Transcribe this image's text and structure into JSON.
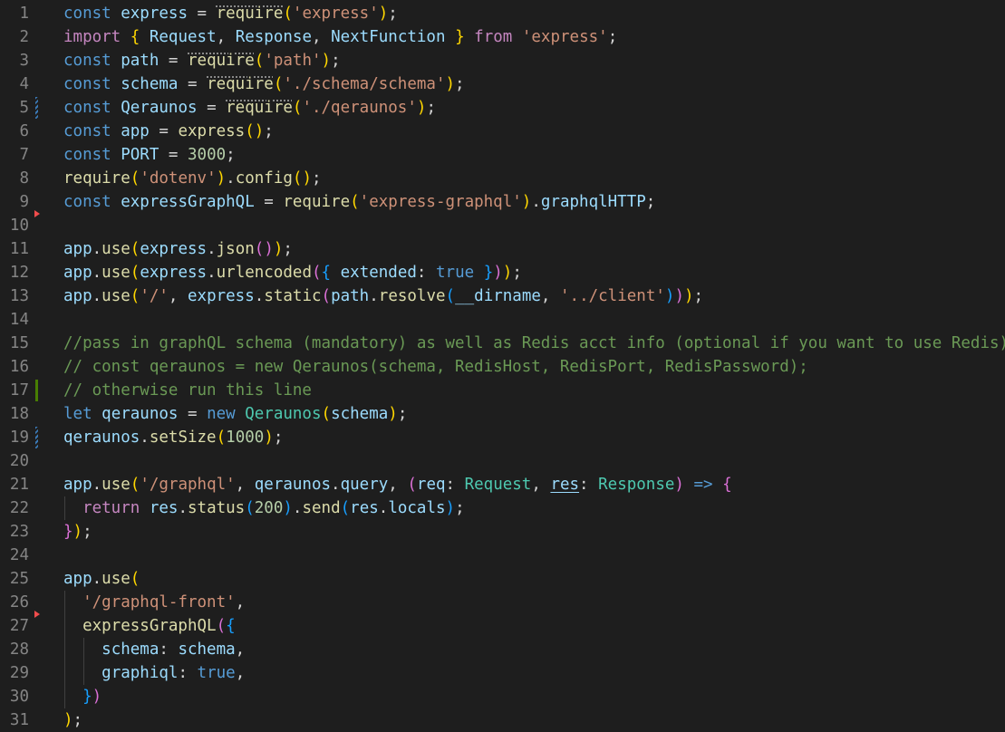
{
  "editor": {
    "theme_colors": {
      "background": "#1e1e1e",
      "line_number": "#858585",
      "keyword": "#569cd6",
      "control": "#c586c0",
      "variable": "#9cdcfe",
      "function": "#dcdcaa",
      "string": "#ce9178",
      "number": "#b5cea8",
      "type": "#4ec9b0",
      "comment": "#6a9955",
      "bracket_1": "#ffd700",
      "bracket_2": "#da70d6",
      "bracket_3": "#179fff"
    },
    "lines": [
      {
        "n": "1",
        "gutter": "",
        "tokens": [
          [
            "kw",
            "const"
          ],
          [
            "plain",
            " "
          ],
          [
            "var",
            "express"
          ],
          [
            "plain",
            " = "
          ],
          [
            "fn-dots",
            "require"
          ],
          [
            "p1",
            "("
          ],
          [
            "str",
            "'express'"
          ],
          [
            "p1",
            ")"
          ],
          [
            "plain",
            ";"
          ]
        ]
      },
      {
        "n": "2",
        "gutter": "",
        "tokens": [
          [
            "ctrl",
            "import"
          ],
          [
            "plain",
            " "
          ],
          [
            "p1",
            "{"
          ],
          [
            "plain",
            " "
          ],
          [
            "var",
            "Request"
          ],
          [
            "plain",
            ", "
          ],
          [
            "var",
            "Response"
          ],
          [
            "plain",
            ", "
          ],
          [
            "var",
            "NextFunction"
          ],
          [
            "plain",
            " "
          ],
          [
            "p1",
            "}"
          ],
          [
            "plain",
            " "
          ],
          [
            "ctrl",
            "from"
          ],
          [
            "plain",
            " "
          ],
          [
            "str",
            "'express'"
          ],
          [
            "plain",
            ";"
          ]
        ]
      },
      {
        "n": "3",
        "gutter": "",
        "tokens": [
          [
            "kw",
            "const"
          ],
          [
            "plain",
            " "
          ],
          [
            "var",
            "path"
          ],
          [
            "plain",
            " = "
          ],
          [
            "fn-dots",
            "require"
          ],
          [
            "p1",
            "("
          ],
          [
            "str",
            "'path'"
          ],
          [
            "p1",
            ")"
          ],
          [
            "plain",
            ";"
          ]
        ]
      },
      {
        "n": "4",
        "gutter": "",
        "tokens": [
          [
            "kw",
            "const"
          ],
          [
            "plain",
            " "
          ],
          [
            "var",
            "schema"
          ],
          [
            "plain",
            " = "
          ],
          [
            "fn-dots",
            "require"
          ],
          [
            "p1",
            "("
          ],
          [
            "str",
            "'./schema/schema'"
          ],
          [
            "p1",
            ")"
          ],
          [
            "plain",
            ";"
          ]
        ]
      },
      {
        "n": "5",
        "gutter": "modified",
        "tokens": [
          [
            "kw",
            "const"
          ],
          [
            "plain",
            " "
          ],
          [
            "var",
            "Qeraunos"
          ],
          [
            "plain",
            " = "
          ],
          [
            "fn-dots",
            "require"
          ],
          [
            "p1",
            "("
          ],
          [
            "str",
            "'./qeraunos'"
          ],
          [
            "p1",
            ")"
          ],
          [
            "plain",
            ";"
          ]
        ]
      },
      {
        "n": "6",
        "gutter": "",
        "tokens": [
          [
            "kw",
            "const"
          ],
          [
            "plain",
            " "
          ],
          [
            "var",
            "app"
          ],
          [
            "plain",
            " = "
          ],
          [
            "fn",
            "express"
          ],
          [
            "p1",
            "()"
          ],
          [
            "plain",
            ";"
          ]
        ]
      },
      {
        "n": "7",
        "gutter": "",
        "tokens": [
          [
            "kw",
            "const"
          ],
          [
            "plain",
            " "
          ],
          [
            "var",
            "PORT"
          ],
          [
            "plain",
            " = "
          ],
          [
            "num",
            "3000"
          ],
          [
            "plain",
            ";"
          ]
        ]
      },
      {
        "n": "8",
        "gutter": "",
        "tokens": [
          [
            "fn",
            "require"
          ],
          [
            "p1",
            "("
          ],
          [
            "str",
            "'dotenv'"
          ],
          [
            "p1",
            ")"
          ],
          [
            "plain",
            "."
          ],
          [
            "fn",
            "config"
          ],
          [
            "p1",
            "()"
          ],
          [
            "plain",
            ";"
          ]
        ]
      },
      {
        "n": "9",
        "gutter": "",
        "tokens": [
          [
            "kw",
            "const"
          ],
          [
            "plain",
            " "
          ],
          [
            "var",
            "expressGraphQL"
          ],
          [
            "plain",
            " = "
          ],
          [
            "fn",
            "require"
          ],
          [
            "p1",
            "("
          ],
          [
            "str",
            "'express-graphql'"
          ],
          [
            "p1",
            ")"
          ],
          [
            "plain",
            "."
          ],
          [
            "var",
            "graphqlHTTP"
          ],
          [
            "plain",
            ";"
          ]
        ]
      },
      {
        "n": "10",
        "gutter": "deleted",
        "tokens": []
      },
      {
        "n": "11",
        "gutter": "",
        "tokens": [
          [
            "var",
            "app"
          ],
          [
            "plain",
            "."
          ],
          [
            "fn",
            "use"
          ],
          [
            "p1",
            "("
          ],
          [
            "var",
            "express"
          ],
          [
            "plain",
            "."
          ],
          [
            "fn",
            "json"
          ],
          [
            "p2",
            "()"
          ],
          [
            "p1",
            ")"
          ],
          [
            "plain",
            ";"
          ]
        ]
      },
      {
        "n": "12",
        "gutter": "",
        "tokens": [
          [
            "var",
            "app"
          ],
          [
            "plain",
            "."
          ],
          [
            "fn",
            "use"
          ],
          [
            "p1",
            "("
          ],
          [
            "var",
            "express"
          ],
          [
            "plain",
            "."
          ],
          [
            "fn",
            "urlencoded"
          ],
          [
            "p2",
            "("
          ],
          [
            "p3",
            "{"
          ],
          [
            "plain",
            " "
          ],
          [
            "var",
            "extended"
          ],
          [
            "plain",
            ": "
          ],
          [
            "kw",
            "true"
          ],
          [
            "plain",
            " "
          ],
          [
            "p3",
            "}"
          ],
          [
            "p2",
            ")"
          ],
          [
            "p1",
            ")"
          ],
          [
            "plain",
            ";"
          ]
        ]
      },
      {
        "n": "13",
        "gutter": "",
        "tokens": [
          [
            "var",
            "app"
          ],
          [
            "plain",
            "."
          ],
          [
            "fn",
            "use"
          ],
          [
            "p1",
            "("
          ],
          [
            "str",
            "'/'"
          ],
          [
            "plain",
            ", "
          ],
          [
            "var",
            "express"
          ],
          [
            "plain",
            "."
          ],
          [
            "fn",
            "static"
          ],
          [
            "p2",
            "("
          ],
          [
            "var",
            "path"
          ],
          [
            "plain",
            "."
          ],
          [
            "fn",
            "resolve"
          ],
          [
            "p3",
            "("
          ],
          [
            "var",
            "__dirname"
          ],
          [
            "plain",
            ", "
          ],
          [
            "str",
            "'../client'"
          ],
          [
            "p3",
            ")"
          ],
          [
            "p2",
            ")"
          ],
          [
            "p1",
            ")"
          ],
          [
            "plain",
            ";"
          ]
        ]
      },
      {
        "n": "14",
        "gutter": "",
        "tokens": []
      },
      {
        "n": "15",
        "gutter": "",
        "tokens": [
          [
            "com",
            "//pass in graphQL schema (mandatory) as well as Redis acct info (optional if you want to use Redis)"
          ]
        ]
      },
      {
        "n": "16",
        "gutter": "",
        "tokens": [
          [
            "com",
            "// const qeraunos = new Qeraunos(schema, RedisHost, RedisPort, RedisPassword);"
          ]
        ]
      },
      {
        "n": "17",
        "gutter": "added",
        "tokens": [
          [
            "com",
            "// otherwise run this line"
          ]
        ]
      },
      {
        "n": "18",
        "gutter": "",
        "tokens": [
          [
            "kw",
            "let"
          ],
          [
            "plain",
            " "
          ],
          [
            "var",
            "qeraunos"
          ],
          [
            "plain",
            " = "
          ],
          [
            "kw",
            "new"
          ],
          [
            "plain",
            " "
          ],
          [
            "type",
            "Qeraunos"
          ],
          [
            "p1",
            "("
          ],
          [
            "var",
            "schema"
          ],
          [
            "p1",
            ")"
          ],
          [
            "plain",
            ";"
          ]
        ]
      },
      {
        "n": "19",
        "gutter": "modified",
        "tokens": [
          [
            "var",
            "qeraunos"
          ],
          [
            "plain",
            "."
          ],
          [
            "fn",
            "setSize"
          ],
          [
            "p1",
            "("
          ],
          [
            "num",
            "1000"
          ],
          [
            "p1",
            ")"
          ],
          [
            "plain",
            ";"
          ]
        ]
      },
      {
        "n": "20",
        "gutter": "",
        "tokens": []
      },
      {
        "n": "21",
        "gutter": "",
        "tokens": [
          [
            "var",
            "app"
          ],
          [
            "plain",
            "."
          ],
          [
            "fn",
            "use"
          ],
          [
            "p1",
            "("
          ],
          [
            "str",
            "'/graphql'"
          ],
          [
            "plain",
            ", "
          ],
          [
            "var",
            "qeraunos"
          ],
          [
            "plain",
            "."
          ],
          [
            "var",
            "query"
          ],
          [
            "plain",
            ", "
          ],
          [
            "p2",
            "("
          ],
          [
            "var",
            "req"
          ],
          [
            "plain",
            ": "
          ],
          [
            "type",
            "Request"
          ],
          [
            "plain",
            ", "
          ],
          [
            "var-ul",
            "res"
          ],
          [
            "plain",
            ": "
          ],
          [
            "type",
            "Response"
          ],
          [
            "p2",
            ")"
          ],
          [
            "plain",
            " "
          ],
          [
            "kw",
            "=>"
          ],
          [
            "plain",
            " "
          ],
          [
            "p2",
            "{"
          ]
        ]
      },
      {
        "n": "22",
        "gutter": "",
        "indent": 1,
        "tokens": [
          [
            "plain",
            "  "
          ],
          [
            "ctrl",
            "return"
          ],
          [
            "plain",
            " "
          ],
          [
            "var",
            "res"
          ],
          [
            "plain",
            "."
          ],
          [
            "fn",
            "status"
          ],
          [
            "p3",
            "("
          ],
          [
            "num",
            "200"
          ],
          [
            "p3",
            ")"
          ],
          [
            "plain",
            "."
          ],
          [
            "fn",
            "send"
          ],
          [
            "p3",
            "("
          ],
          [
            "var",
            "res"
          ],
          [
            "plain",
            "."
          ],
          [
            "var",
            "locals"
          ],
          [
            "p3",
            ")"
          ],
          [
            "plain",
            ";"
          ]
        ]
      },
      {
        "n": "23",
        "gutter": "",
        "tokens": [
          [
            "p2",
            "}"
          ],
          [
            "p1",
            ")"
          ],
          [
            "plain",
            ";"
          ]
        ]
      },
      {
        "n": "24",
        "gutter": "",
        "tokens": []
      },
      {
        "n": "25",
        "gutter": "",
        "tokens": [
          [
            "var",
            "app"
          ],
          [
            "plain",
            "."
          ],
          [
            "fn",
            "use"
          ],
          [
            "p1",
            "("
          ]
        ]
      },
      {
        "n": "26",
        "gutter": "",
        "indent": 1,
        "tokens": [
          [
            "plain",
            "  "
          ],
          [
            "str",
            "'/graphql-front'"
          ],
          [
            "plain",
            ","
          ]
        ]
      },
      {
        "n": "27",
        "gutter": "deleted",
        "indent": 1,
        "tokens": [
          [
            "plain",
            "  "
          ],
          [
            "fn",
            "expressGraphQL"
          ],
          [
            "p2",
            "("
          ],
          [
            "p3",
            "{"
          ]
        ]
      },
      {
        "n": "28",
        "gutter": "",
        "indent": 2,
        "tokens": [
          [
            "plain",
            "    "
          ],
          [
            "var",
            "schema"
          ],
          [
            "plain",
            ": "
          ],
          [
            "var",
            "schema"
          ],
          [
            "plain",
            ","
          ]
        ]
      },
      {
        "n": "29",
        "gutter": "",
        "indent": 2,
        "tokens": [
          [
            "plain",
            "    "
          ],
          [
            "var",
            "graphiql"
          ],
          [
            "plain",
            ": "
          ],
          [
            "kw",
            "true"
          ],
          [
            "plain",
            ","
          ]
        ]
      },
      {
        "n": "30",
        "gutter": "",
        "indent": 1,
        "tokens": [
          [
            "plain",
            "  "
          ],
          [
            "p3",
            "}"
          ],
          [
            "p2",
            ")"
          ]
        ]
      },
      {
        "n": "31",
        "gutter": "",
        "tokens": [
          [
            "p1",
            ")"
          ],
          [
            "plain",
            ";"
          ]
        ]
      }
    ]
  }
}
